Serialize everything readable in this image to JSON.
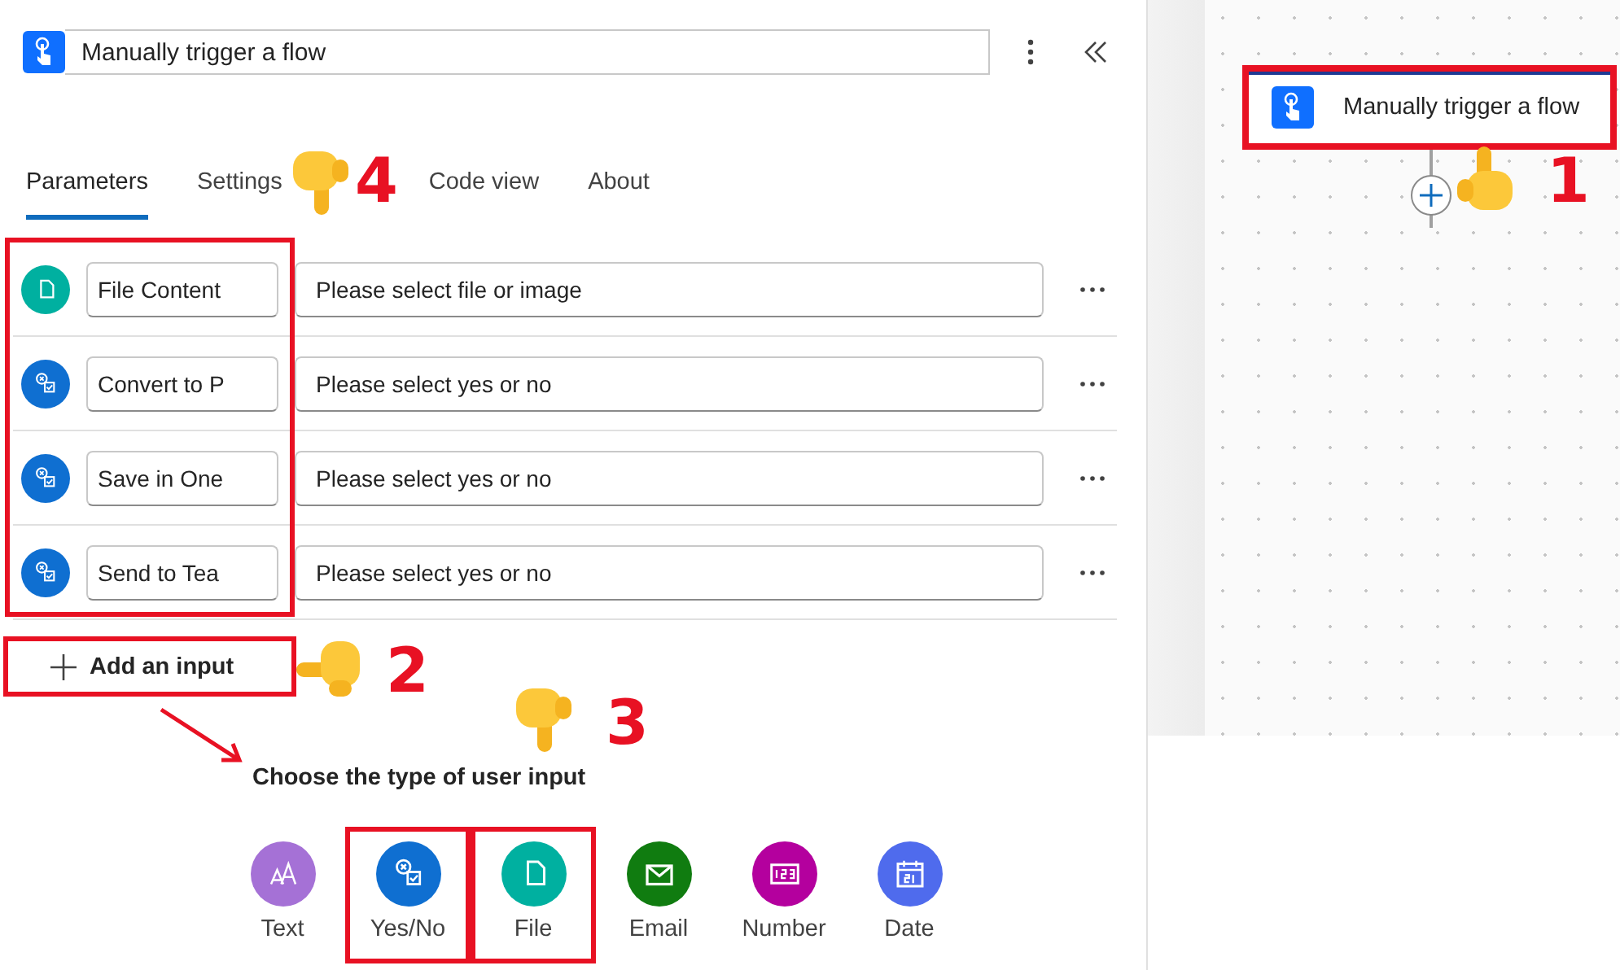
{
  "header": {
    "title": "Manually trigger a flow"
  },
  "tabs": [
    {
      "label": "Parameters",
      "selected": true
    },
    {
      "label": "Settings",
      "selected": false
    },
    {
      "label": "Code view",
      "selected": false
    },
    {
      "label": "About",
      "selected": false
    }
  ],
  "inputs": [
    {
      "kind": "file",
      "name": "File Content",
      "placeholder": "Please select file or image"
    },
    {
      "kind": "yesno",
      "name": "Convert to P",
      "placeholder": "Please select yes or no"
    },
    {
      "kind": "yesno",
      "name": "Save in One",
      "placeholder": "Please select yes or no"
    },
    {
      "kind": "yesno",
      "name": "Send to Tea",
      "placeholder": "Please select yes or no"
    }
  ],
  "add_input": {
    "label": "Add an input",
    "highlighted": true
  },
  "chooser": {
    "title": "Choose the type of user input",
    "options": [
      {
        "kind": "text",
        "label": "Text",
        "highlighted": false
      },
      {
        "kind": "yesno",
        "label": "Yes/No",
        "highlighted": true
      },
      {
        "kind": "file",
        "label": "File",
        "highlighted": true
      },
      {
        "kind": "email",
        "label": "Email",
        "highlighted": false
      },
      {
        "kind": "number",
        "label": "Number",
        "highlighted": false
      },
      {
        "kind": "date",
        "label": "Date",
        "highlighted": false
      }
    ]
  },
  "canvas": {
    "node": {
      "title": "Manually trigger a flow",
      "highlighted": true
    }
  },
  "annotations": [
    {
      "label": "1",
      "kind": "up"
    },
    {
      "label": "2",
      "kind": "left"
    },
    {
      "label": "3",
      "kind": "down"
    },
    {
      "label": "4",
      "kind": "down"
    }
  ]
}
